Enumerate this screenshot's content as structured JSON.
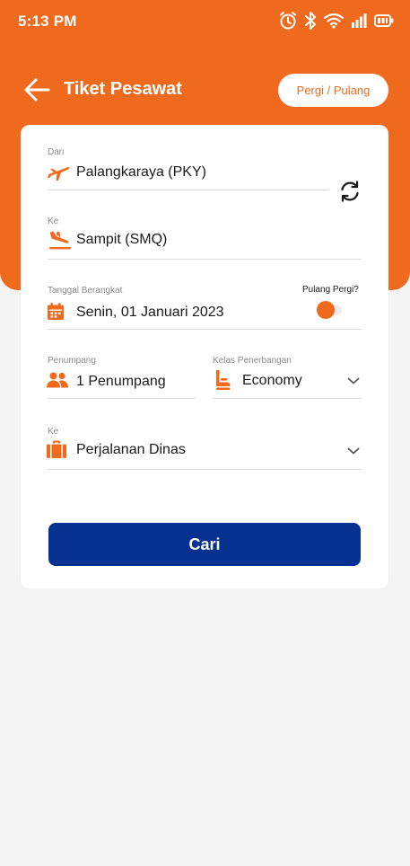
{
  "status_bar": {
    "time": "5:13 PM",
    "icons": [
      "alarm-icon",
      "bluetooth-icon",
      "wifi-icon",
      "signal-icon",
      "battery-icon"
    ]
  },
  "header": {
    "title": "Tiket Pesawat",
    "trip_type_button": "Pergi / Pulang"
  },
  "form": {
    "origin": {
      "label": "Dari",
      "value": "Palangkaraya (PKY)",
      "icon": "plane-departure-icon"
    },
    "destination": {
      "label": "Ke",
      "value": "Sampit (SMQ)",
      "icon": "plane-arrival-icon"
    },
    "departure_date": {
      "label": "Tanggal Berangkat",
      "value": "Senin, 01 Januari 2023",
      "icon": "calendar-icon"
    },
    "round_trip": {
      "label": "Pulang Pergi?",
      "enabled": false
    },
    "passengers": {
      "label": "Penumpang",
      "value": "1 Penumpang",
      "icon": "users-icon"
    },
    "cabin_class": {
      "label": "Kelas Penerbangan",
      "value": "Economy",
      "icon": "seat-icon"
    },
    "purpose": {
      "label": "Ke",
      "value": "Perjalanan Dinas",
      "icon": "briefcase-icon"
    },
    "search_button": "Cari"
  },
  "colors": {
    "accent": "#f06a1e",
    "primary_button": "#073190",
    "background": "#f4f4f4"
  }
}
